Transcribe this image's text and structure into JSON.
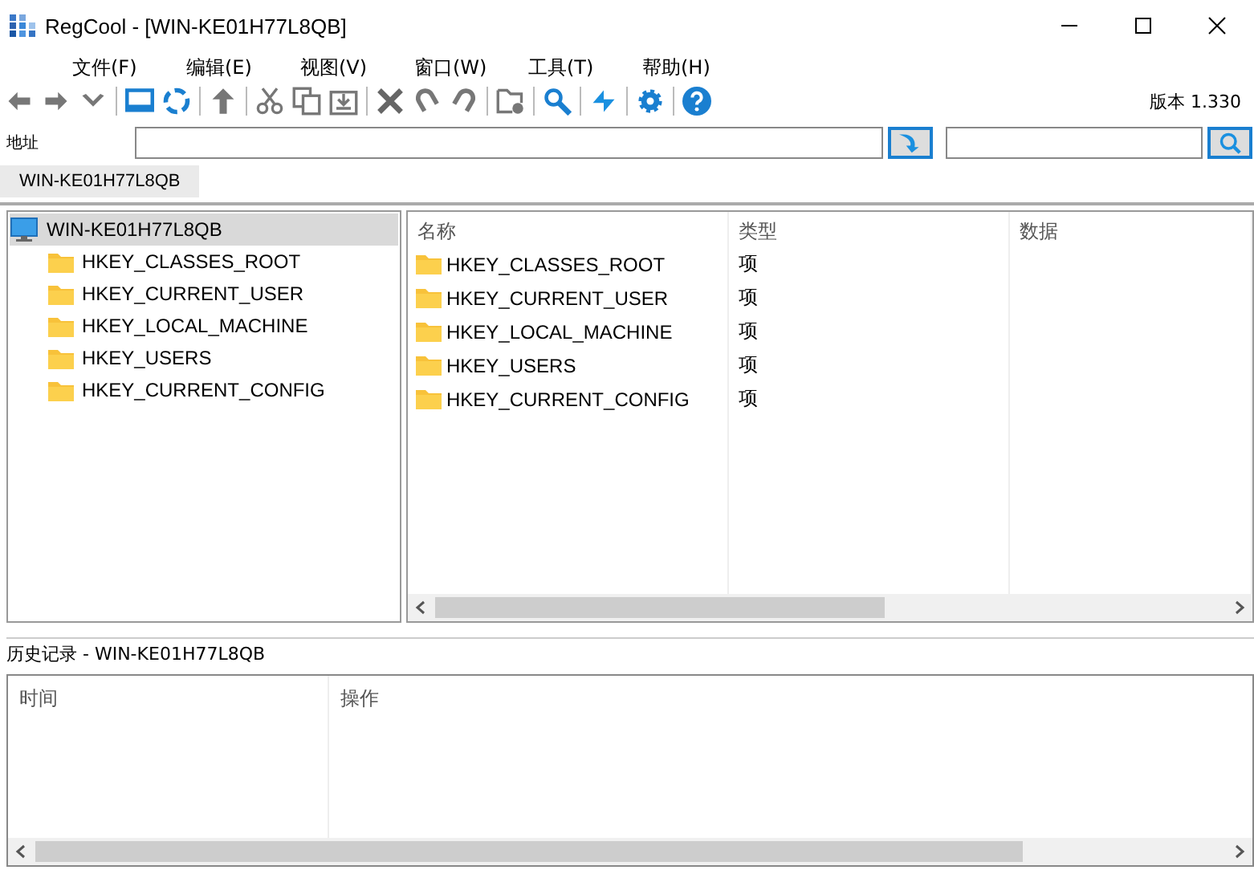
{
  "window": {
    "title": "RegCool - [WIN-KE01H77L8QB]"
  },
  "menu": [
    "文件(F)",
    "编辑(E)",
    "视图(V)",
    "窗口(W)",
    "工具(T)",
    "帮助(H)"
  ],
  "version": "版本 1.330",
  "address": {
    "label": "地址"
  },
  "tabs": [
    {
      "label": "WIN-KE01H77L8QB",
      "selected": true
    }
  ],
  "tree": {
    "label": "WIN-KE01H77L8QB",
    "selected": true,
    "children": [
      {
        "label": "HKEY_CLASSES_ROOT",
        "selected": false
      },
      {
        "label": "HKEY_CURRENT_USER",
        "selected": false
      },
      {
        "label": "HKEY_LOCAL_MACHINE",
        "selected": false
      },
      {
        "label": "HKEY_USERS",
        "selected": false
      },
      {
        "label": "HKEY_CURRENT_CONFIG",
        "selected": false
      }
    ]
  },
  "list": {
    "columns": [
      "名称",
      "类型",
      "数据"
    ],
    "rows": [
      {
        "name": "HKEY_CLASSES_ROOT",
        "type": "项"
      },
      {
        "name": "HKEY_CURRENT_USER",
        "type": "项"
      },
      {
        "name": "HKEY_LOCAL_MACHINE",
        "type": "项"
      },
      {
        "name": "HKEY_USERS",
        "type": "项"
      },
      {
        "name": "HKEY_CURRENT_CONFIG",
        "type": "项"
      }
    ]
  },
  "history": {
    "title": "历史记录 - WIN-KE01H77L8QB",
    "columns": [
      "时间",
      "操作"
    ]
  }
}
